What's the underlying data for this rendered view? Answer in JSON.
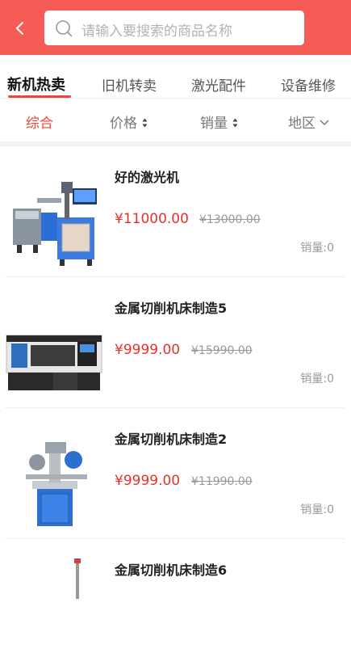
{
  "header": {
    "back_icon": "chevron-left-icon",
    "search_placeholder": "请输入要搜索的商品名称",
    "search_icon": "search-icon",
    "bg_color": "#f65b56"
  },
  "tabs": [
    {
      "label": "新机热卖",
      "active": true
    },
    {
      "label": "旧机转卖",
      "active": false
    },
    {
      "label": "激光配件",
      "active": false
    },
    {
      "label": "设备维修",
      "active": false
    }
  ],
  "filters": {
    "overall": "综合",
    "price": "价格",
    "sales": "销量",
    "region": "地区"
  },
  "products": [
    {
      "name": "好的激光机",
      "price": "¥11000.00",
      "old_price": "¥13000.00",
      "sales": "销量:0",
      "image_icon": "laser-marking-machine-image"
    },
    {
      "name": "金属切削机床制造5",
      "price": "¥9999.00",
      "old_price": "¥15990.00",
      "sales": "销量:0",
      "image_icon": "cnc-lathe-image"
    },
    {
      "name": "金属切削机床制造2",
      "price": "¥9999.00",
      "old_price": "¥11990.00",
      "sales": "销量:0",
      "image_icon": "grinding-machine-image"
    },
    {
      "name": "金属切削机床制造6",
      "price": "",
      "old_price": "",
      "sales": "",
      "image_icon": "machine-image"
    }
  ],
  "colors": {
    "accent": "#f0433b",
    "price": "#e8302a"
  }
}
